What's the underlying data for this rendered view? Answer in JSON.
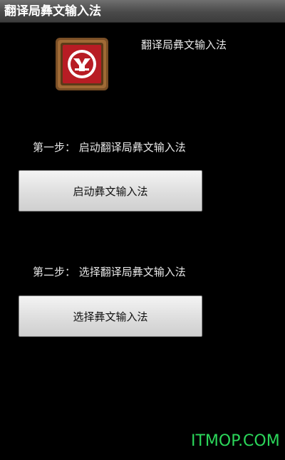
{
  "window": {
    "title": "翻译局彝文输入法"
  },
  "app": {
    "icon": "yi-input-logo-icon",
    "name": "翻译局彝文输入法"
  },
  "steps": [
    {
      "label": "第一步： 启动翻译局彝文输入法",
      "button_label": "启动彝文输入法"
    },
    {
      "label": "第二步： 选择翻译局彝文输入法",
      "button_label": "选择彝文输入法"
    }
  ],
  "watermark": {
    "text": "ITMOP.COM"
  },
  "colors": {
    "background": "#000000",
    "titlebar": "#4a4a4a",
    "button": "#dcdcdc",
    "icon_red": "#b81c24",
    "icon_frame": "#8a5a2b",
    "watermark": "#2bd65a"
  }
}
